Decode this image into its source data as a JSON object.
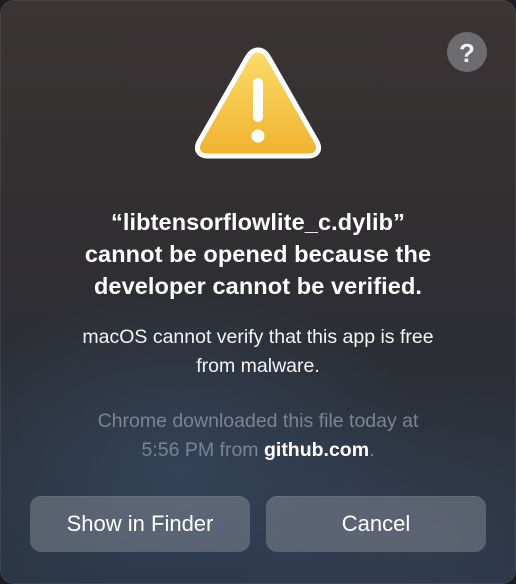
{
  "dialog": {
    "help_icon_glyph": "?",
    "icon": "warning-triangle-icon",
    "icon_colors": {
      "fill": "#f5c13a",
      "fill_light": "#fbdc6a",
      "border": "#ffffff",
      "mark": "#ffffff"
    },
    "title_lines": [
      "“libtensorflowlite_c.dylib”",
      "cannot be opened because the",
      "developer cannot be verified."
    ],
    "message_lines": [
      "macOS cannot verify that this app is free",
      "from malware."
    ],
    "info": {
      "line1": "Chrome downloaded this file today at",
      "line2_prefix": "5:56 PM from ",
      "host": "github.com",
      "line2_suffix": "."
    },
    "buttons": {
      "show_in_finder": "Show in Finder",
      "cancel": "Cancel"
    }
  }
}
